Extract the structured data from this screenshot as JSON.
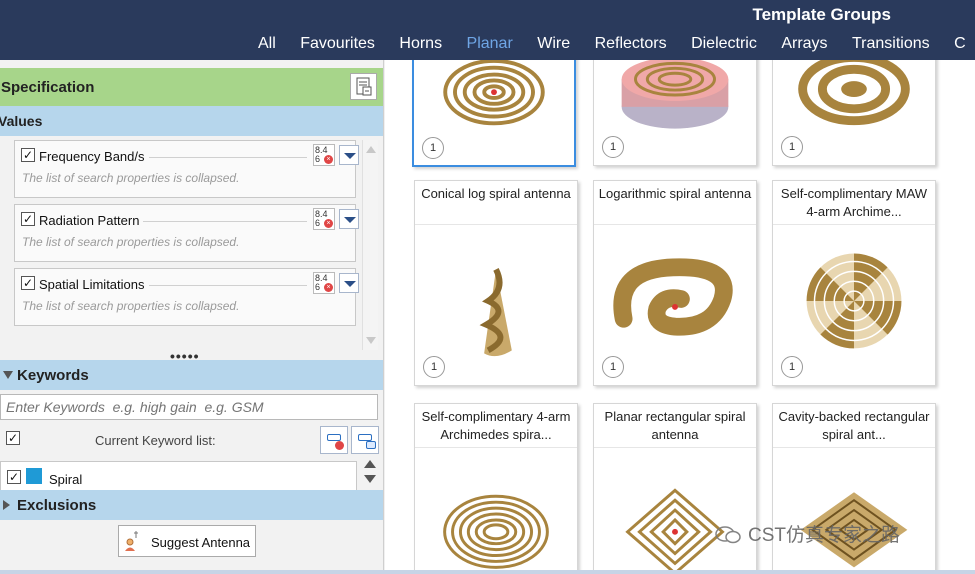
{
  "header": {
    "title": "Template Groups",
    "tabs": [
      {
        "label": "All"
      },
      {
        "label": "Favourites"
      },
      {
        "label": "Horns"
      },
      {
        "label": "Planar"
      },
      {
        "label": "Wire"
      },
      {
        "label": "Reflectors"
      },
      {
        "label": "Dielectric"
      },
      {
        "label": "Arrays"
      },
      {
        "label": "Transitions"
      },
      {
        "label": "C"
      }
    ],
    "active_tab": "Planar",
    "accent_color": "#6fa6e6",
    "bar_color": "#2a3a5c"
  },
  "spec": {
    "title": "Specification",
    "values_title": "Values",
    "properties": [
      {
        "label": "Frequency Band/s",
        "checked": true,
        "desc": "The list of search properties is collapsed.",
        "icon_text": "8.4 6"
      },
      {
        "label": "Radiation Pattern",
        "checked": true,
        "desc": "The list of search properties is collapsed.",
        "icon_text": "8.4 6"
      },
      {
        "label": "Spatial Limitations",
        "checked": true,
        "desc": "The list of search properties is collapsed.",
        "icon_text": "8.4 6"
      }
    ],
    "splitter": "•••••"
  },
  "keywords": {
    "title": "Keywords",
    "placeholder": "Enter Keywords  e.g. high gain  e.g. GSM",
    "current_label": "Current Keyword list:",
    "items": [
      {
        "name": "Spiral",
        "checked": true,
        "color": "#1f9ad6"
      }
    ]
  },
  "exclusions": {
    "title": "Exclusions"
  },
  "suggest": {
    "label": "Suggest Antenna"
  },
  "cards": [
    {
      "title": "",
      "count": "1",
      "selected": true
    },
    {
      "title": "",
      "count": "1",
      "selected": false
    },
    {
      "title": "",
      "count": "1",
      "selected": false
    },
    {
      "title": "Conical log spiral antenna",
      "count": "1",
      "selected": false
    },
    {
      "title": "Logarithmic spiral antenna",
      "count": "1",
      "selected": false
    },
    {
      "title": "Self-complimentary MAW 4-arm Archime...",
      "count": "1",
      "selected": false
    },
    {
      "title": "Self-complimentary 4-arm Archimedes spira...",
      "count": "",
      "selected": false
    },
    {
      "title": "Planar rectangular spiral antenna",
      "count": "",
      "selected": false
    },
    {
      "title": "Cavity-backed rectangular spiral ant...",
      "count": "",
      "selected": false
    }
  ],
  "watermark": "CST仿真专家之路",
  "colors": {
    "spec_green": "#a7d58a",
    "section_blue": "#b6d6ec",
    "spiral_gold": "#a8843e"
  }
}
